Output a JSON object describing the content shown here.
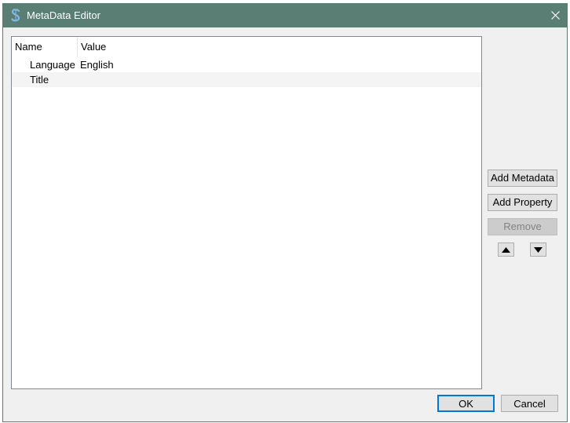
{
  "window": {
    "title": "MetaData Editor"
  },
  "icons": {
    "app": "app-logo-icon",
    "close": "close-icon",
    "move_up": "triangle-up-icon",
    "move_down": "triangle-down-icon"
  },
  "table": {
    "columns": [
      "Name",
      "Value"
    ],
    "rows": [
      {
        "name": "Language",
        "value": "English"
      },
      {
        "name": "Title",
        "value": ""
      }
    ]
  },
  "side_buttons": {
    "add_metadata": "Add Metadata",
    "add_property": "Add Property",
    "remove": "Remove"
  },
  "footer": {
    "ok": "OK",
    "cancel": "Cancel"
  },
  "colors": {
    "titlebar": "#5a7d74",
    "default_button_border": "#0078d7"
  }
}
